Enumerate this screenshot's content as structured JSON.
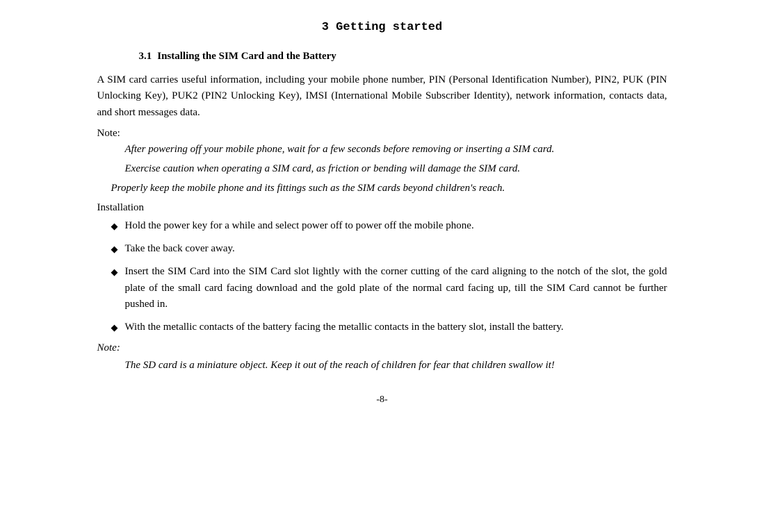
{
  "page": {
    "title": "3  Getting started",
    "section": {
      "number": "3.1",
      "heading": "Installing the SIM Card and the Battery"
    },
    "intro_text": "A SIM card carries useful information, including your mobile phone number, PIN (Personal Identification Number),  PIN2,  PUK  (PIN  Unlocking  Key),  PUK2  (PIN2  Unlocking  Key),  IMSI  (International  Mobile Subscriber Identity), network information, contacts data, and short messages data.",
    "note_label": "Note:",
    "note_lines": [
      "After powering off your mobile phone, wait for a few seconds before removing or inserting a SIM card.",
      "Exercise caution when operating a SIM card, as friction or bending will damage the SIM card.",
      "Properly keep the mobile phone and its fittings such as the SIM cards beyond children's reach."
    ],
    "installation_label": "Installation",
    "bullets": [
      "Hold the power key for a while and select power off to power off the mobile phone.",
      "Take the back cover away.",
      "Insert the SIM Card into the SIM Card slot lightly with the corner cutting of the card aligning to the notch of the slot, the gold plate of the small card facing download and the gold plate of the normal card facing up, till the SIM Card cannot be further pushed in.",
      "With  the  metallic  contacts  of  the  battery  facing  the  metallic  contacts  in  the  battery  slot,  install  the battery."
    ],
    "bottom_note_label": "Note:",
    "bottom_note_text": "The SD card is a miniature object. Keep it out of the reach of children for fear that children swallow it!",
    "page_number": "-8-"
  }
}
